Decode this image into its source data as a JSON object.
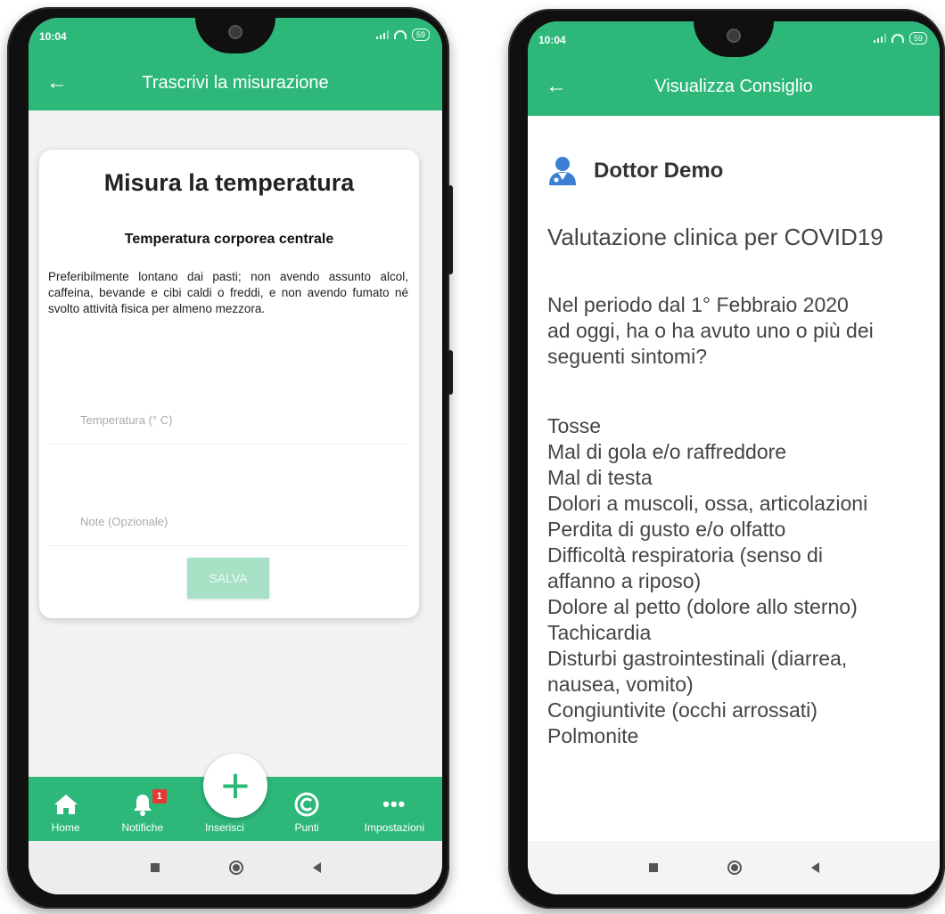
{
  "left_phone": {
    "status": {
      "time": "10:04",
      "battery": "59"
    },
    "appbar": {
      "title": "Trascrivi la misurazione"
    },
    "card": {
      "title": "Misura la temperatura",
      "subtitle": "Temperatura corporea centrale",
      "description": "Preferibilmente lontano dai pasti; non avendo assunto alcol, caffeina, bevande e cibi caldi o freddi, e non avendo fumato né svolto attività fisica per almeno mezzora.",
      "temperature_placeholder": "Temperatura (° C)",
      "notes_placeholder": "Note (Opzionale)",
      "save_label": "SALVA"
    },
    "tabs": [
      {
        "label": "Home",
        "icon": "home-icon"
      },
      {
        "label": "Notifiche",
        "icon": "bell-icon",
        "badge": "1"
      },
      {
        "label": "Inserisci",
        "icon": "plus-icon"
      },
      {
        "label": "Punti",
        "icon": "copyright-icon"
      },
      {
        "label": "Impostazioni",
        "icon": "more-icon"
      }
    ]
  },
  "right_phone": {
    "status": {
      "time": "10:04",
      "battery": "59"
    },
    "appbar": {
      "title": "Visualizza Consiglio"
    },
    "doctor_name": "Dottor Demo",
    "heading": "Valutazione clinica per COVID19",
    "question": [
      "Nel periodo dal 1° Febbraio 2020",
      "ad oggi, ha o ha avuto uno o più dei",
      "seguenti sintomi?"
    ],
    "symptoms": [
      "Tosse",
      "Mal di gola e/o raffreddore",
      "Mal di testa",
      "Dolori a muscoli, ossa, articolazioni",
      "Perdita di gusto e/o olfatto",
      "Difficoltà respiratoria (senso di",
      "affanno a riposo)",
      "Dolore al petto (dolore allo sterno)",
      "Tachicardia",
      "Disturbi gastrointestinali (diarrea,",
      "nausea, vomito)",
      "Congiuntivite (occhi arrossati)",
      "Polmonite"
    ]
  },
  "colors": {
    "primary": "#2db87a",
    "badge": "#e53935",
    "button_disabled": "#a8e2c6"
  }
}
